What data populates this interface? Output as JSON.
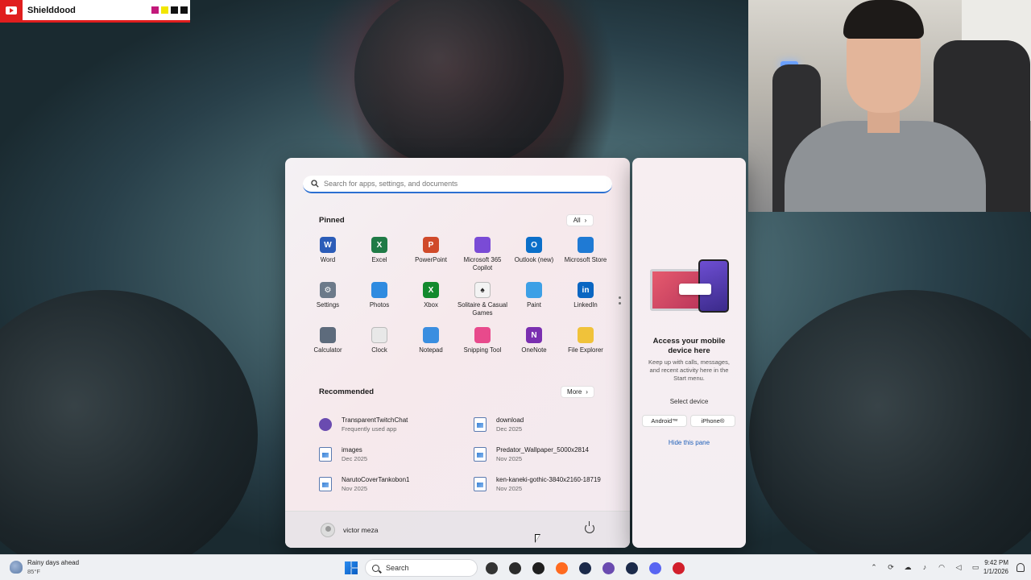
{
  "stream_label": {
    "name": "Shielddood",
    "swatch_colors": [
      "#c2187a",
      "#f2e600",
      "#111111",
      "#111111"
    ]
  },
  "start_menu": {
    "search": {
      "placeholder": "Search for apps, settings, and documents"
    },
    "pinned": {
      "title": "Pinned",
      "all_label": "All",
      "apps": [
        {
          "label": "Word",
          "icon": "word-icon",
          "color": "#2b5cb8",
          "glyph": "W"
        },
        {
          "label": "Excel",
          "icon": "excel-icon",
          "color": "#1f7a46",
          "glyph": "X"
        },
        {
          "label": "PowerPoint",
          "icon": "powerpoint-icon",
          "color": "#d04a2a",
          "glyph": "P"
        },
        {
          "label": "Microsoft 365 Copilot",
          "icon": "copilot-icon",
          "color": "#7a4bd6",
          "glyph": ""
        },
        {
          "label": "Outlook (new)",
          "icon": "outlook-icon",
          "color": "#0b6fc9",
          "glyph": "O"
        },
        {
          "label": "Microsoft Store",
          "icon": "store-icon",
          "color": "#1f7ad4",
          "glyph": ""
        },
        {
          "label": "Settings",
          "icon": "gear-icon",
          "color": "#6c7a8a",
          "glyph": "⚙"
        },
        {
          "label": "Photos",
          "icon": "photos-icon",
          "color": "#2f8be0",
          "glyph": ""
        },
        {
          "label": "Xbox",
          "icon": "xbox-icon",
          "color": "#138a2e",
          "glyph": "X"
        },
        {
          "label": "Solitaire & Casual Games",
          "icon": "solitaire-icon",
          "color": "#f3f3f3",
          "glyph": "♠"
        },
        {
          "label": "Paint",
          "icon": "paint-icon",
          "color": "#3da0e6",
          "glyph": ""
        },
        {
          "label": "LinkedIn",
          "icon": "linkedin-icon",
          "color": "#0a66c2",
          "glyph": "in"
        },
        {
          "label": "Calculator",
          "icon": "calculator-icon",
          "color": "#5d6b7c",
          "glyph": ""
        },
        {
          "label": "Clock",
          "icon": "clock-icon",
          "color": "#e8e8e8",
          "glyph": ""
        },
        {
          "label": "Notepad",
          "icon": "notepad-icon",
          "color": "#3a8ee0",
          "glyph": ""
        },
        {
          "label": "Snipping Tool",
          "icon": "snipping-tool-icon",
          "color": "#e84a8c",
          "glyph": ""
        },
        {
          "label": "OneNote",
          "icon": "onenote-icon",
          "color": "#7a2fb0",
          "glyph": "N"
        },
        {
          "label": "File Explorer",
          "icon": "folder-icon",
          "color": "#f0c23a",
          "glyph": ""
        }
      ]
    },
    "recommended": {
      "title": "Recommended",
      "more_label": "More",
      "items": [
        {
          "name": "TransparentTwitchChat",
          "sub": "Frequently used app",
          "icon": "twitch-chat-app-icon"
        },
        {
          "name": "download",
          "sub": "Dec 2025",
          "icon": "image-file-icon"
        },
        {
          "name": "images",
          "sub": "Dec 2025",
          "icon": "image-file-icon"
        },
        {
          "name": "Predator_Wallpaper_5000x2814",
          "sub": "Nov 2025",
          "icon": "image-file-icon"
        },
        {
          "name": "NarutoCoverTankobon1",
          "sub": "Nov 2025",
          "icon": "image-file-icon"
        },
        {
          "name": "ken-kaneki-gothic-3840x2160-18719",
          "sub": "Nov 2025",
          "icon": "image-file-icon"
        }
      ]
    },
    "footer": {
      "user_name": "victor meza"
    }
  },
  "phone_pane": {
    "title": "Access your mobile device here",
    "description": "Keep up with calls, messages, and recent activity here in the Start menu.",
    "select_label": "Select device",
    "android_label": "Android™",
    "iphone_label": "iPhone®",
    "hide_label": "Hide this pane"
  },
  "taskbar": {
    "weather": {
      "line1": "Rainy days ahead",
      "line2": "85°F"
    },
    "search_label": "Search",
    "apps": [
      {
        "icon": "task-view-icon",
        "color": "#333333"
      },
      {
        "icon": "obs-icon",
        "color": "#2b2b2b"
      },
      {
        "icon": "epic-games-icon",
        "color": "#1f1f1f"
      },
      {
        "icon": "firefox-icon",
        "color": "#ff6a1f"
      },
      {
        "icon": "steam-icon",
        "color": "#1b2a4a"
      },
      {
        "icon": "twitch-chat-app-icon",
        "color": "#6a4bb0"
      },
      {
        "icon": "steam-icon",
        "color": "#1b2a4a"
      },
      {
        "icon": "discord-icon",
        "color": "#5865f2"
      },
      {
        "icon": "app-red-icon",
        "color": "#d21f2b"
      }
    ],
    "clock": {
      "time": "9:42 PM",
      "date": "1/1/2026"
    }
  }
}
